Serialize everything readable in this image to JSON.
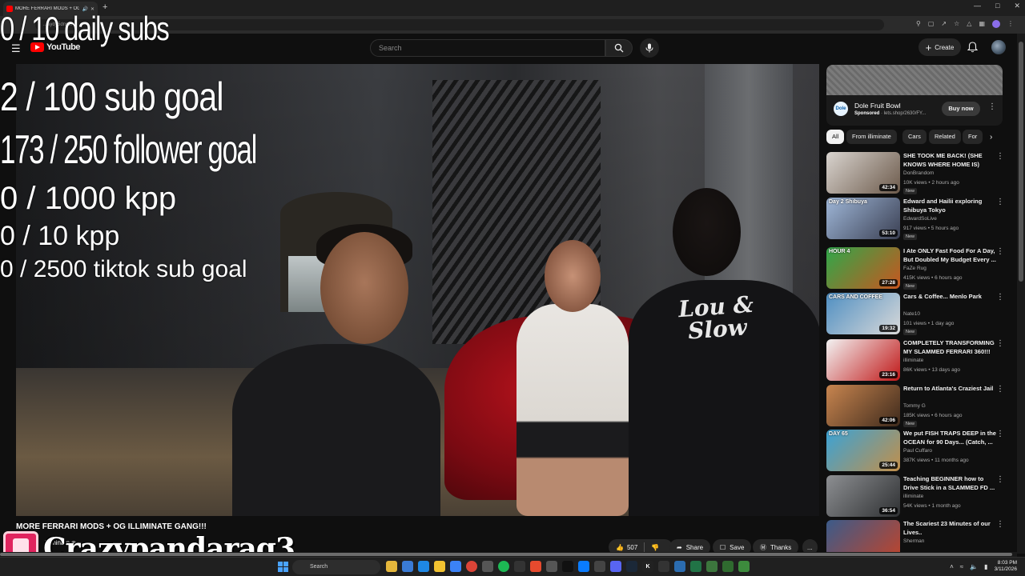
{
  "browser": {
    "tab_title": "MORE FERRARI MODS + OG",
    "url": "...ayd_5dns6I",
    "new_tab": "+"
  },
  "header": {
    "logo_text": "YouTube",
    "search_placeholder": "Search",
    "create_label": "Create"
  },
  "overlay": {
    "daily_subs": "0 / 10 daily subs",
    "sub_goal": "2  / 100 sub goal",
    "follower_goal": "173 / 250 follower goal",
    "kpp_1000": "0 / 1000 kpp",
    "kpp_10": "0 / 10 kpp",
    "tiktok_goal": "0 / 2500 tiktok sub goal",
    "streamer_name": "Crazypandarag3",
    "shirt_text": "Lou & Slow"
  },
  "video": {
    "title": "MORE FERRARI MODS + OG ILLIMINATE GANG!!!",
    "channel": "illiminate",
    "likes": "507",
    "share_label": "Share",
    "save_label": "Save",
    "thanks_label": "Thanks",
    "more": "..."
  },
  "ad": {
    "title": "Dole Fruit Bowl",
    "sponsored": "Sponsored",
    "url": "lets.shop/2630/FY...",
    "buy_label": "Buy now",
    "logo": "Dole"
  },
  "chips": [
    "All",
    "From illiminate",
    "Cars",
    "Related",
    "For"
  ],
  "recommendations": [
    {
      "title": "SHE TOOK ME BACK! (SHE KNOWS WHERE HOME IS)",
      "channel": "DonBrandom",
      "meta": "10K views • 2 hours ago",
      "badge": "New",
      "duration": "42:34",
      "thumb_text": "",
      "color1": "#d9d4cf",
      "color2": "#6c5a4b"
    },
    {
      "title": "Edward and Hailii exploring Shibuya Tokyo",
      "channel": "EdwardSoLive",
      "meta": "917 views • 5 hours ago",
      "badge": "New",
      "duration": "53:10",
      "thumb_text": "Day 2 Shibuya",
      "color1": "#9fb7d8",
      "color2": "#3a3f52"
    },
    {
      "title": "I Ate ONLY Fast Food For A Day, But Doubled My Budget Every ...",
      "channel": "FaZe Rug",
      "meta": "415K views • 6 hours ago",
      "badge": "New",
      "duration": "27:28",
      "thumb_text": "HOUR 4",
      "color1": "#2fa84a",
      "color2": "#c8561f"
    },
    {
      "title": "Cars & Coffee... Menlo Park",
      "channel": "Nate10",
      "meta": "101 views • 1 day ago",
      "badge": "New",
      "duration": "19:32",
      "thumb_text": "CARS AND COFFEE",
      "color1": "#4f8fc2",
      "color2": "#d9d9d9"
    },
    {
      "title": "COMPLETELY TRANSFORMING MY SLAMMED FERRARI 360!!!",
      "channel": "illiminate",
      "meta": "86K views • 13 days ago",
      "badge": "",
      "duration": "23:16",
      "thumb_text": "",
      "color1": "#f3f3f3",
      "color2": "#c01818"
    },
    {
      "title": "Return to Atlanta's Craziest Jail",
      "channel": "Tommy G",
      "meta": "185K views • 6 hours ago",
      "badge": "New",
      "duration": "42:06",
      "thumb_text": "",
      "color1": "#c8854f",
      "color2": "#3e2a1c"
    },
    {
      "title": "We put FISH TRAPS DEEP in the OCEAN for 90 Days... (Catch, ...",
      "channel": "Paul Cuffaro",
      "meta": "387K views • 11 months ago",
      "badge": "",
      "duration": "25:44",
      "thumb_text": "DAY 65",
      "color1": "#3aa3d6",
      "color2": "#c28f4a"
    },
    {
      "title": "Teaching BEGINNER how to Drive Stick in a SLAMMED FD ...",
      "channel": "illiminate",
      "meta": "54K views • 1 month ago",
      "badge": "",
      "duration": "36:54",
      "thumb_text": "",
      "color1": "#8d8f92",
      "color2": "#2e3032"
    },
    {
      "title": "The Scariest 23 Minutes of our Lives..",
      "channel": "Sherman",
      "meta": "",
      "badge": "",
      "duration": "",
      "thumb_text": "",
      "color1": "#3b5b8a",
      "color2": "#c1442a"
    }
  ],
  "taskbar": {
    "search_label": "Search",
    "time": "8:03 PM",
    "date": "3/11/2026"
  },
  "colors": {
    "youtube_red": "#ff0000",
    "background": "#0f0f0f",
    "chip_bg": "#272727"
  }
}
